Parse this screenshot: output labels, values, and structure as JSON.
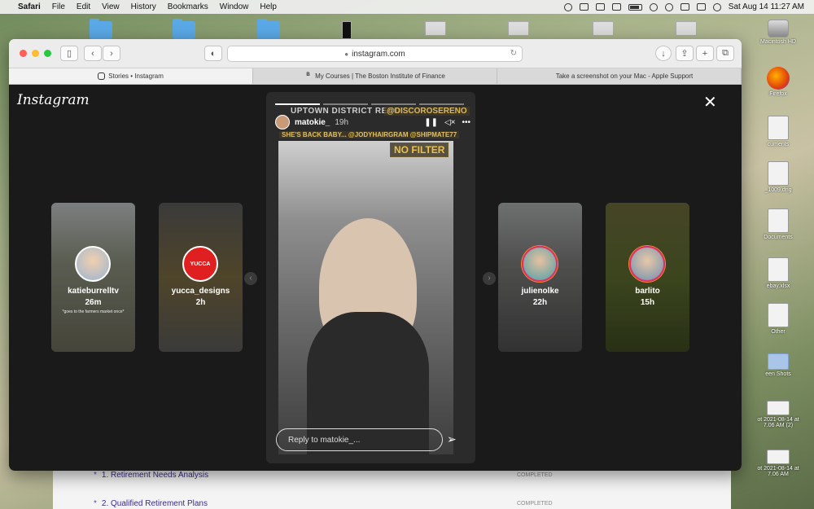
{
  "menubar": {
    "app": "Safari",
    "items": [
      "File",
      "Edit",
      "View",
      "History",
      "Bookmarks",
      "Window",
      "Help"
    ],
    "datetime": "Sat Aug 14  11:27 AM"
  },
  "desktop": {
    "right_items": [
      "Macintosh HD",
      "Firefox",
      "cuments",
      "_1009.dng",
      "Documents",
      "ebay.xlsx",
      "Other",
      "een Shots",
      "ot 2021-08-14 at\n7.06 AM (2)",
      "ot 2021-08-14 at\n7.06 AM"
    ]
  },
  "browser": {
    "url": "instagram.com",
    "tabs": [
      {
        "label": "Stories • Instagram",
        "icon": "instagram-icon"
      },
      {
        "label": "My Courses | The Boston Institute of Finance",
        "icon": "b-icon"
      },
      {
        "label": "Take a screenshot on your Mac - Apple Support",
        "icon": "apple-icon"
      }
    ]
  },
  "instagram": {
    "logo": "Instagram",
    "stories_left": [
      {
        "user": "katieburrelltv",
        "age": "26m",
        "caption": "*goes to the farmers market once*"
      },
      {
        "user": "yucca_designs",
        "age": "2h"
      }
    ],
    "stories_right": [
      {
        "user": "julienolke",
        "age": "22h"
      },
      {
        "user": "barlito",
        "age": "15h"
      }
    ],
    "main": {
      "user": "matokie_",
      "time": "19h",
      "sticker_top": "UPTOWN DISTRICT RENO",
      "sticker_tag": "@DISCOROSERENO",
      "sticker_line": "SHE'S BACK BABY... @JODYHAIRGRAM @SHIPMATE77",
      "nofilter": "NO FILTER",
      "reply_placeholder": "Reply to matokie_..."
    }
  },
  "page_behind": {
    "items": [
      {
        "label": "1. Retirement Needs Analysis",
        "status": "COMPLETED"
      },
      {
        "label": "2. Qualified Retirement Plans",
        "status": "COMPLETED"
      }
    ]
  }
}
